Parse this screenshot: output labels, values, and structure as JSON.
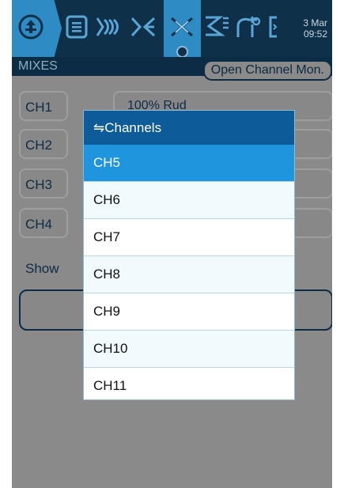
{
  "topbar": {
    "icons": [
      "model-select-icon",
      "model-setup-icon",
      "outputs-icon",
      "inputs-icon",
      "mixes-icon",
      "logical-switches-icon",
      "curves-icon",
      "telemetry-icon"
    ],
    "date": "3 Mar",
    "time": "09:52",
    "colors": {
      "bar": "#0f3049",
      "active": "#2f8bc4"
    }
  },
  "page": {
    "title": "MIXES",
    "open_monitor_label": "Open Channel Mon."
  },
  "channels": [
    {
      "label": "CH1",
      "mix": "100% Rud"
    },
    {
      "label": "CH2",
      "mix": ""
    },
    {
      "label": "CH3",
      "mix": ""
    },
    {
      "label": "CH4",
      "mix": ""
    }
  ],
  "show_label": "Show",
  "popup": {
    "title": "⇋Channels",
    "options": [
      "CH5",
      "CH6",
      "CH7",
      "CH8",
      "CH9",
      "CH10",
      "CH11"
    ],
    "selected": "CH5"
  }
}
